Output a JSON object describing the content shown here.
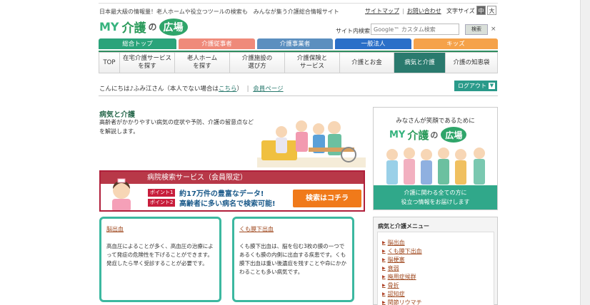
{
  "header": {
    "tagline": "日本最大級の情報量！老人ホームや役立つツールの検索も　みんなが集う介護総合情報サイト",
    "links": [
      "サイトマップ",
      "お問い合わせ"
    ],
    "font_size_label": "文字サイズ",
    "font_sizes": [
      "中",
      "大"
    ],
    "logo": {
      "my": "MY",
      "kaigo": "介護",
      "no": "の",
      "hiroba": "広場"
    },
    "search": {
      "label": "サイト内検索",
      "placeholder": "Google™ カスタム検索",
      "button": "検索",
      "close": "×"
    }
  },
  "category_tabs": [
    {
      "label": "総合トップ",
      "color": "#2aa37a"
    },
    {
      "label": "介護従事者",
      "color": "#ef8a7a"
    },
    {
      "label": "介護事業者",
      "color": "#5b8fbf"
    },
    {
      "label": "一般法人",
      "color": "#2a6fc8"
    },
    {
      "label": "キッズ",
      "color": "#f5a24a"
    }
  ],
  "nav": [
    {
      "label": "TOP"
    },
    {
      "label": "在宅介護サービス\nを探す"
    },
    {
      "label": "老人ホーム\nを探す"
    },
    {
      "label": "介護施設の\n選び方"
    },
    {
      "label": "介護保険と\nサービス"
    },
    {
      "label": "介護とお金"
    },
    {
      "label": "病気と介護",
      "active": true
    },
    {
      "label": "介護の知恵袋"
    }
  ],
  "greeting": {
    "prefix": "こんにちは♪ふみ江さん（本人でない場合は",
    "link": "こちら",
    "suffix": "）",
    "member_link": "会員ページ"
  },
  "logout": {
    "label": "ログアウト",
    "icon": "chevron-down-icon"
  },
  "page": {
    "title": "病気と介護",
    "description": "高齢者がかかりやすい病気の症状や予防、介護の留意点などを解説します。"
  },
  "banner": {
    "title": "病院検索サービス（会員限定）",
    "point1_badge": "ポイント1",
    "point1_text": "約17万件の豊富なデータ!",
    "point2_badge": "ポイント2",
    "point2_text": "高齢者に多い病名で検索可能!",
    "button": "検索はコチラ"
  },
  "cards": [
    {
      "title": "脳出血",
      "body": "高血圧によることが多く、高血圧の治療によって発症の危険性を下げることができます。発症したら早く受診することが必要です。"
    },
    {
      "title": "くも膜下出血",
      "body": "くも膜下出血は、脳を包む3枚の膜の一つであるくも膜の内側に出血する疾患です。くも膜下出血は重い後遺症を残すことや命にかかわることも多い病気です。"
    }
  ],
  "side_panel": {
    "heading": "みなさんが笑顔であるために",
    "logo": {
      "my": "MY",
      "kaigo": "介護",
      "no": "の",
      "hiroba": "広場"
    },
    "line1": "介護に関わる全ての方に",
    "line2": "役立つ情報をお届けします"
  },
  "menu": {
    "title": "病気と介護メニュー",
    "items": [
      "脳出血",
      "くも膜下出血",
      "脳梗塞",
      "衰弱",
      "廃用症候群",
      "骨折",
      "認知症",
      "関節リウマチ"
    ]
  }
}
